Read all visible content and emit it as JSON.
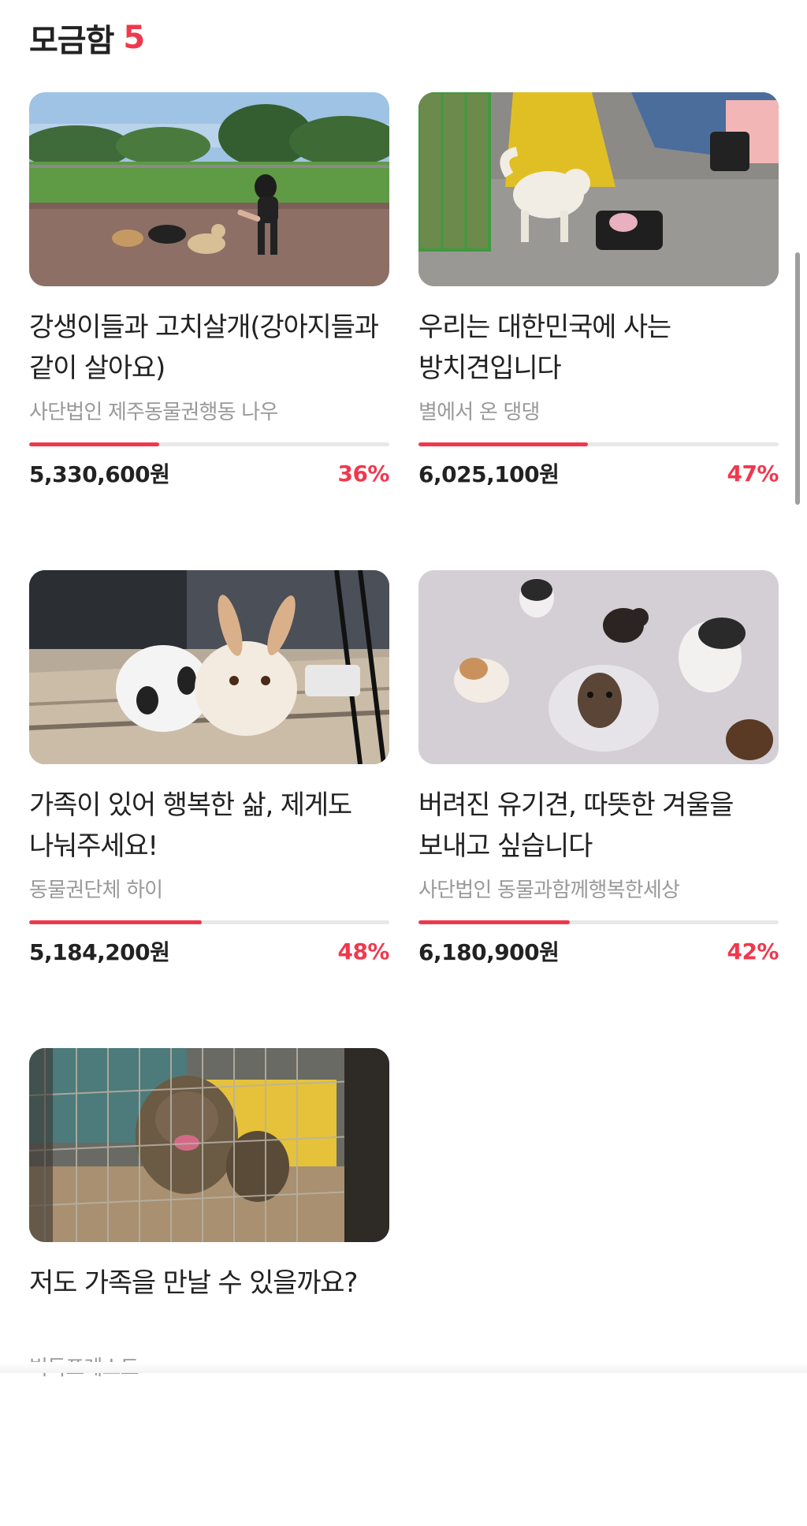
{
  "header": {
    "title": "모금함",
    "count": "5"
  },
  "colors": {
    "accent": "#f0384d",
    "muted_text": "#999999",
    "track": "#e8e8e8"
  },
  "cards": [
    {
      "title": "강생이들과 고치살개(강아지들과 같이 살아요)",
      "organization": "사단법인 제주동물권행동 나우",
      "amount": "5,330,600원",
      "percent": "36%",
      "progress": 0.36,
      "image": "girl-with-puppies-photo"
    },
    {
      "title": "우리는 대한민국에 사는 방치견입니다",
      "organization": "별에서 온 댕댕",
      "amount": "6,025,100원",
      "percent": "47%",
      "progress": 0.47,
      "image": "tethered-dog-photo"
    },
    {
      "title": "가족이 있어 행복한 삶, 제게도 나눠주세요!",
      "organization": "동물권단체 하이",
      "amount": "5,184,200원",
      "percent": "48%",
      "progress": 0.48,
      "image": "two-rabbits-photo"
    },
    {
      "title": "버려진 유기견, 따뜻한 겨울을 보내고 싶습니다",
      "organization": "사단법인 동물과함께행복한세상",
      "amount": "6,180,900원",
      "percent": "42%",
      "progress": 0.42,
      "image": "shelter-dogs-photo"
    },
    {
      "title": "저도 가족을 만날 수 있을까요?",
      "organization": "빅독포레스트",
      "image": "caged-dog-photo"
    }
  ]
}
